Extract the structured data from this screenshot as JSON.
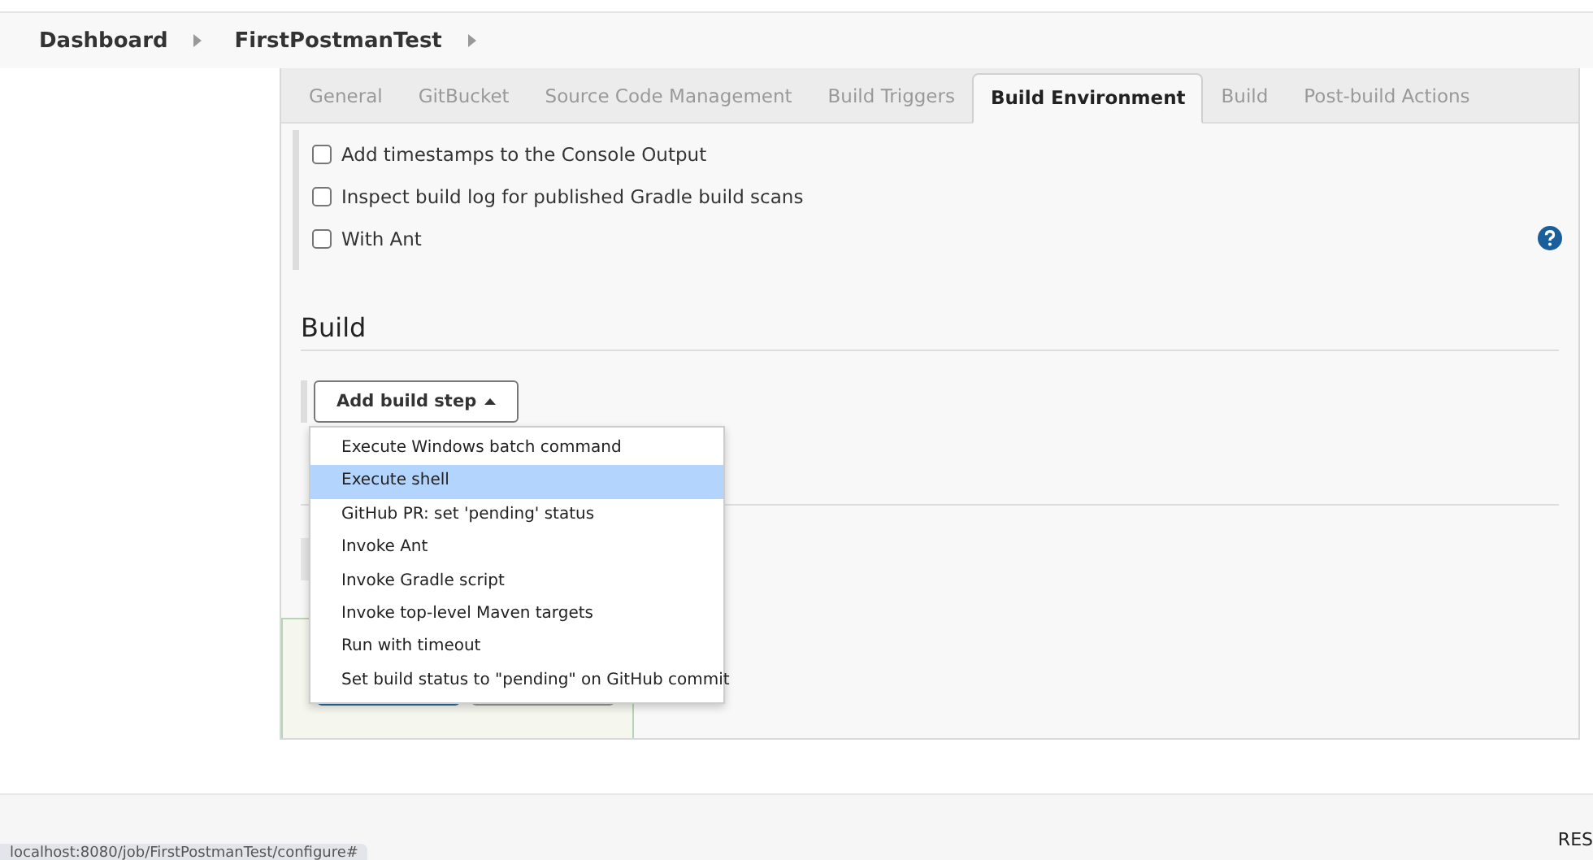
{
  "breadcrumbs": [
    "Dashboard",
    "FirstPostmanTest"
  ],
  "tabs": [
    {
      "label": "General",
      "selected": false
    },
    {
      "label": "GitBucket",
      "selected": false
    },
    {
      "label": "Source Code Management",
      "selected": false
    },
    {
      "label": "Build Triggers",
      "selected": false
    },
    {
      "label": "Build Environment",
      "selected": true
    },
    {
      "label": "Build",
      "selected": false
    },
    {
      "label": "Post-build Actions",
      "selected": false
    }
  ],
  "options": [
    {
      "label": "Add timestamps to the Console Output",
      "checked": false
    },
    {
      "label": "Inspect build log for published Gradle build scans",
      "checked": false
    },
    {
      "label": "With Ant",
      "checked": false
    }
  ],
  "build_section": {
    "title": "Build",
    "button": "Add build step"
  },
  "menu": [
    {
      "label": "Execute Windows batch command",
      "selected": false
    },
    {
      "label": "Execute shell",
      "selected": true
    },
    {
      "label": "GitHub PR: set 'pending' status",
      "selected": false
    },
    {
      "label": "Invoke Ant",
      "selected": false
    },
    {
      "label": "Invoke Gradle script",
      "selected": false
    },
    {
      "label": "Invoke top-level Maven targets",
      "selected": false
    },
    {
      "label": "Run with timeout",
      "selected": false
    },
    {
      "label": "Set build status to \"pending\" on GitHub commit",
      "selected": false
    }
  ],
  "footer": {
    "text": "RES"
  },
  "status_bar": {
    "url": "localhost:8080/job/FirstPostmanTest/configure#"
  }
}
